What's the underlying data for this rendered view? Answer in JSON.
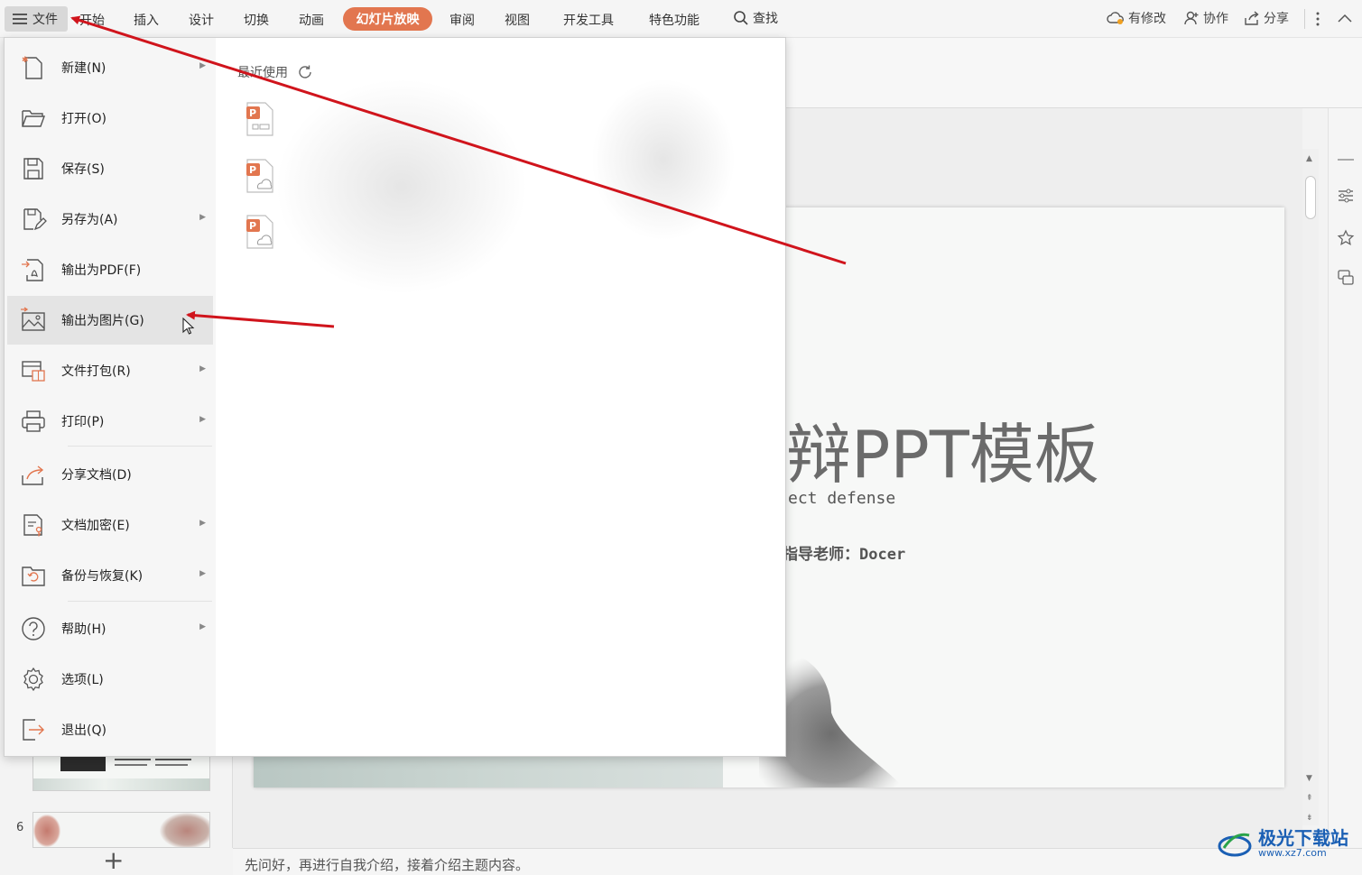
{
  "menubar": {
    "file_label": "文件",
    "tabs": [
      "开始",
      "插入",
      "设计",
      "切换",
      "动画"
    ],
    "active_tab": "幻灯片放映",
    "tabs_after": [
      "审阅",
      "视图",
      "开发工具",
      "特色功能"
    ],
    "search_label": "查找",
    "modified_label": "有修改",
    "collab_label": "协作",
    "share_label": "分享"
  },
  "file_menu": {
    "items": [
      {
        "label": "新建(N)",
        "icon": "new-file-icon",
        "has_submenu": true
      },
      {
        "label": "打开(O)",
        "icon": "open-folder-icon",
        "has_submenu": false
      },
      {
        "label": "保存(S)",
        "icon": "save-icon",
        "has_submenu": false
      },
      {
        "label": "另存为(A)",
        "icon": "save-as-icon",
        "has_submenu": true
      },
      {
        "label": "输出为PDF(F)",
        "icon": "export-pdf-icon",
        "has_submenu": false
      },
      {
        "label": "输出为图片(G)",
        "icon": "export-image-icon",
        "has_submenu": false
      },
      {
        "label": "文件打包(R)",
        "icon": "package-icon",
        "has_submenu": true
      },
      {
        "label": "打印(P)",
        "icon": "print-icon",
        "has_submenu": true
      },
      {
        "label": "分享文档(D)",
        "icon": "share-doc-icon",
        "has_submenu": false
      },
      {
        "label": "文档加密(E)",
        "icon": "encrypt-icon",
        "has_submenu": true
      },
      {
        "label": "备份与恢复(K)",
        "icon": "backup-icon",
        "has_submenu": true
      },
      {
        "label": "帮助(H)",
        "icon": "help-icon",
        "has_submenu": true
      },
      {
        "label": "选项(L)",
        "icon": "options-gear-icon",
        "has_submenu": false
      },
      {
        "label": "退出(Q)",
        "icon": "exit-icon",
        "has_submenu": false
      }
    ],
    "recent_label": "最近使用"
  },
  "slide": {
    "title": "辩PPT模板",
    "subtitle": "ect defense",
    "teacher": "指导老师：Docer"
  },
  "thumbnails": {
    "slide_number": "6",
    "add_label": "+"
  },
  "notes": {
    "text": "先问好，再进行自我介绍，接着介绍主题内容。"
  },
  "watermark": {
    "name": "极光下载站",
    "url": "www.xz7.com"
  },
  "colors": {
    "active_tab": "#e2764f",
    "annotation_arrow": "#d0141c",
    "watermark": "#1a5fb4"
  }
}
